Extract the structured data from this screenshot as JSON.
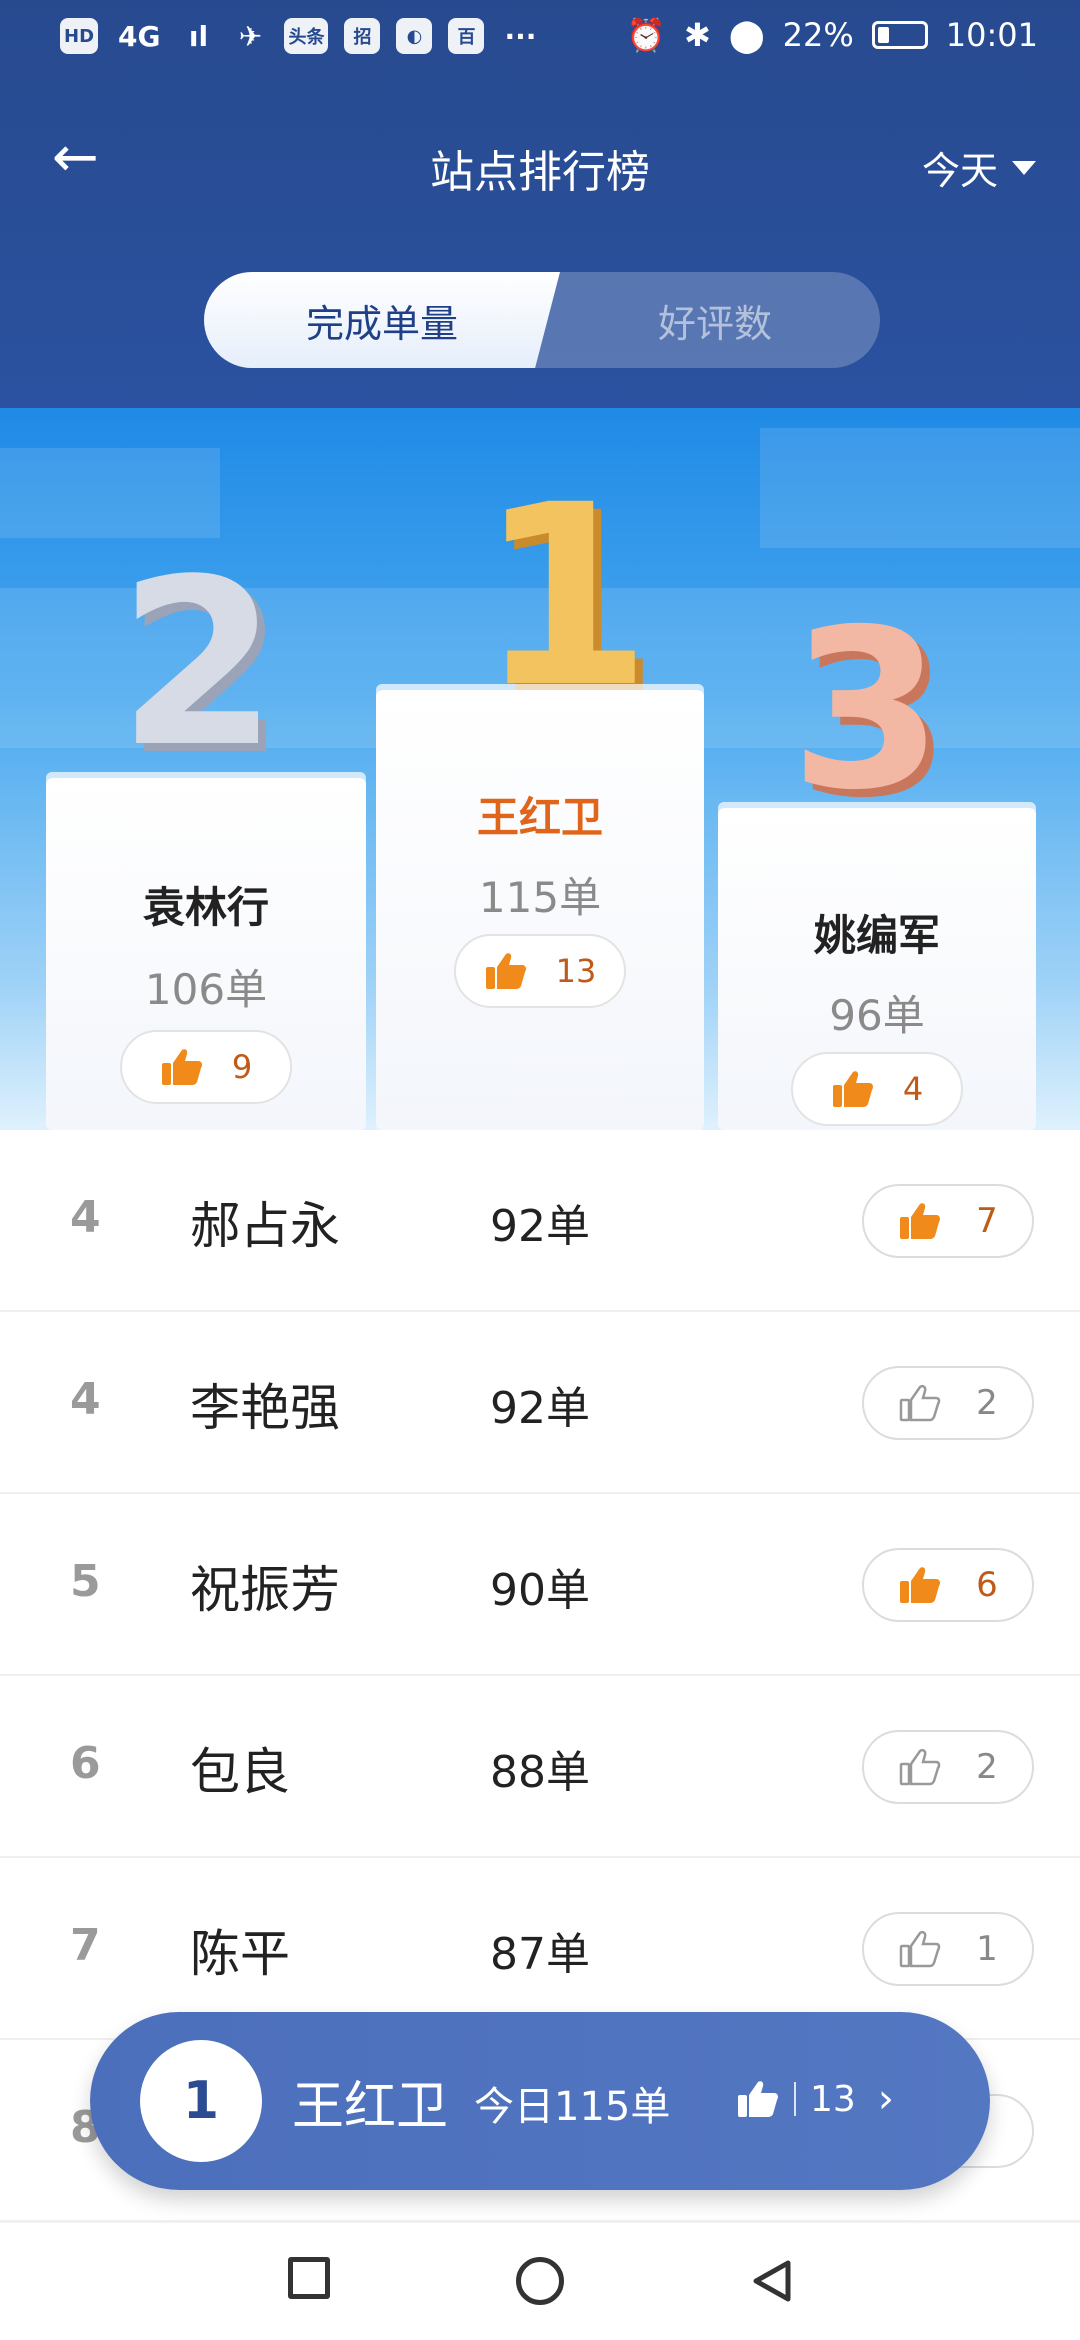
{
  "status_bar": {
    "left_icons": [
      "HD",
      "4G",
      "ıl",
      "✈",
      "头条",
      "招",
      "◐",
      "百",
      "···"
    ],
    "battery": "22%",
    "time": "10:01"
  },
  "topbar": {
    "title": "站点排行榜",
    "date_filter": "今天"
  },
  "tabs": {
    "active": "完成单量",
    "inactive": "好评数"
  },
  "podium": {
    "second": {
      "place": "2",
      "name": "袁林行",
      "count": "106单",
      "likes": "9"
    },
    "first": {
      "place": "1",
      "name": "王红卫",
      "count": "115单",
      "likes": "13"
    },
    "third": {
      "place": "3",
      "name": "姚编军",
      "count": "96单",
      "likes": "4"
    }
  },
  "rows": [
    {
      "rank": "4",
      "name": "郝占永",
      "count": "92单",
      "likes": "7",
      "liked": true
    },
    {
      "rank": "4",
      "name": "李艳强",
      "count": "92单",
      "likes": "2",
      "liked": false
    },
    {
      "rank": "5",
      "name": "祝振芳",
      "count": "90单",
      "likes": "6",
      "liked": true
    },
    {
      "rank": "6",
      "name": "包良",
      "count": "88单",
      "likes": "2",
      "liked": false
    },
    {
      "rank": "7",
      "name": "陈平",
      "count": "87单",
      "likes": "1",
      "liked": false
    },
    {
      "rank": "8",
      "name": "",
      "count": "",
      "likes": "",
      "liked": false
    }
  ],
  "my_rank": {
    "rank": "1",
    "name": "王红卫",
    "today": "今日115单",
    "likes": "13"
  },
  "colors": {
    "header_bg": "#2b52a0",
    "accent_orange": "#f08a1a",
    "name_gold": "#e0651a"
  }
}
